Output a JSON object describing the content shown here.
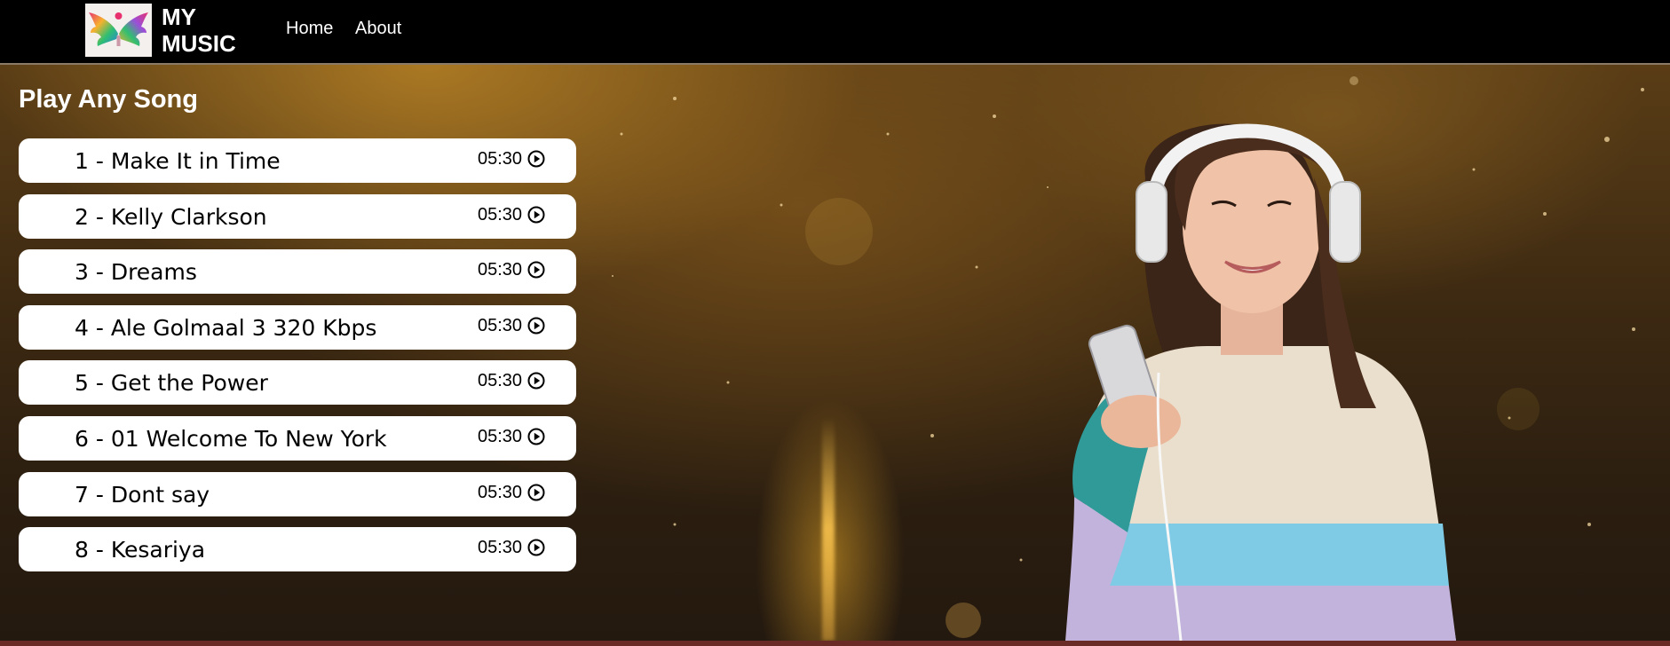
{
  "navbar": {
    "brand_line1": "MY",
    "brand_line2": "MUSIC",
    "links": [
      {
        "label": "Home"
      },
      {
        "label": "About"
      }
    ]
  },
  "main": {
    "title": "Play Any Song",
    "songs": [
      {
        "title": "1 - Make It in Time",
        "duration": "05:30"
      },
      {
        "title": "2 - Kelly Clarkson",
        "duration": "05:30"
      },
      {
        "title": "3 - Dreams",
        "duration": "05:30"
      },
      {
        "title": "4 - Ale Golmaal 3 320 Kbps",
        "duration": "05:30"
      },
      {
        "title": "5 - Get the Power",
        "duration": "05:30"
      },
      {
        "title": "6 - 01 Welcome To New York",
        "duration": "05:30"
      },
      {
        "title": "7 - Dont say",
        "duration": "05:30"
      },
      {
        "title": "8 - Kesariya",
        "duration": "05:30"
      }
    ]
  },
  "icons": {
    "logo": "wings-logo-icon",
    "play": "play-circle-icon"
  },
  "colors": {
    "navbar_bg": "#000000",
    "hero_gold": "#5a3d16",
    "card_bg": "#ffffff",
    "bottom_bar": "#6a2a26"
  }
}
